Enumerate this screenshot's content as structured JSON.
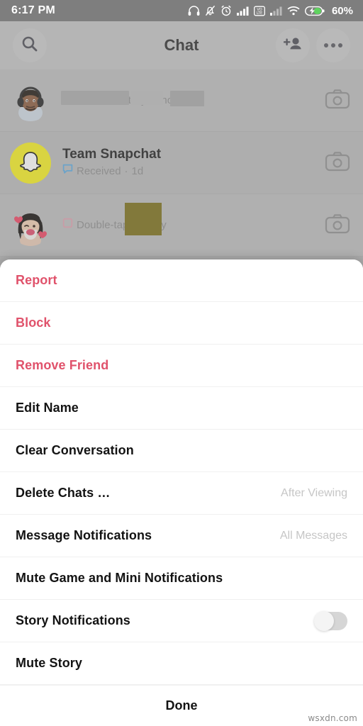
{
  "status_bar": {
    "time": "6:17 PM",
    "battery_percent": "60%",
    "icons": [
      "headphones-icon",
      "bell-muted-icon",
      "alarm-clock-icon",
      "signal-bars-icon",
      "volte-icon",
      "signal-bars-2-icon",
      "wifi-icon",
      "battery-charging-icon"
    ]
  },
  "header": {
    "title": "Chat",
    "search_icon": "search-icon",
    "add_friend_icon": "add-friend-icon",
    "more_icon": "more-options-icon"
  },
  "chat_list": [
    {
      "name": "",
      "name_redacted": true,
      "status": "Screenshot",
      "separator": "·",
      "time": "just now",
      "status_icon": "screenshot-arrow-icon",
      "avatar": "bitmoji-headphones-avatar",
      "camera_icon": "camera-icon"
    },
    {
      "name": "Team Snapchat",
      "name_redacted": false,
      "status": "Received",
      "separator": "·",
      "time": "1d",
      "status_icon": "chat-received-icon",
      "avatar": "snapchat-ghost-avatar",
      "camera_icon": "camera-icon"
    },
    {
      "name": "",
      "name_redacted": true,
      "status": "Double-tap to reply",
      "separator": "",
      "time": "",
      "status_icon": "snap-opened-icon",
      "avatar": "bitmoji-hearts-avatar",
      "camera_icon": "camera-icon"
    }
  ],
  "action_sheet": {
    "items": [
      {
        "label": "Report",
        "style": "danger",
        "value": "",
        "control": "none"
      },
      {
        "label": "Block",
        "style": "danger",
        "value": "",
        "control": "none"
      },
      {
        "label": "Remove Friend",
        "style": "danger",
        "value": "",
        "control": "none"
      },
      {
        "label": "Edit Name",
        "style": "normal",
        "value": "",
        "control": "none"
      },
      {
        "label": "Clear Conversation",
        "style": "normal",
        "value": "",
        "control": "none"
      },
      {
        "label": "Delete Chats …",
        "style": "normal",
        "value": "After Viewing",
        "control": "none"
      },
      {
        "label": "Message Notifications",
        "style": "normal",
        "value": "All Messages",
        "control": "none"
      },
      {
        "label": "Mute Game and Mini Notifications",
        "style": "normal",
        "value": "",
        "control": "none"
      },
      {
        "label": "Story Notifications",
        "style": "normal",
        "value": "",
        "control": "toggle",
        "toggle_on": false
      },
      {
        "label": "Mute Story",
        "style": "normal",
        "value": "",
        "control": "none"
      }
    ],
    "done_label": "Done"
  },
  "watermark": "wsxdn.com",
  "colors": {
    "danger": "#e0526b",
    "sheet_bg": "#ffffff",
    "app_bg": "#bcbcbc",
    "status_bar_bg": "#7e7e7e",
    "snapchat_yellow": "#fffc00",
    "value_text": "#c6c6c6"
  }
}
